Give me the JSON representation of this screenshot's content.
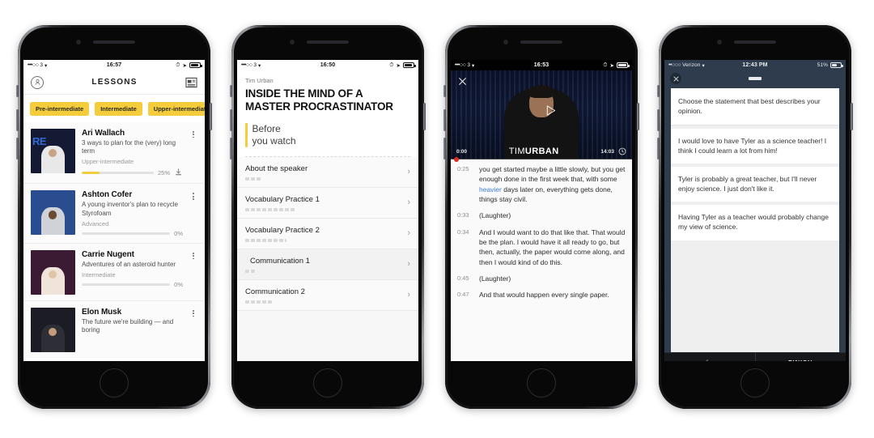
{
  "phones": {
    "p1": {
      "status": {
        "carrier": "3",
        "signal": "•••○○",
        "time": "16:57",
        "battery_pct": 80
      },
      "header": {
        "title": "LESSONS",
        "avatar_icon": "avatar-icon",
        "news_icon": "news-icon"
      },
      "chips": [
        {
          "label": "Pre-intermediate"
        },
        {
          "label": "Intermediate"
        },
        {
          "label": "Upper-intermediate"
        }
      ],
      "lessons": [
        {
          "name": "Ari Wallach",
          "desc": "3 ways to plan for the (very) long term",
          "level": "Upper-intermediate",
          "progress": 25,
          "progress_label": "25%",
          "has_download": true,
          "thumb_text": "RE"
        },
        {
          "name": "Ashton Cofer",
          "desc": "A young inventor's plan to recycle Styrofoam",
          "level": "Advanced",
          "progress": 0,
          "progress_label": "0%",
          "has_download": false,
          "thumb_text": ""
        },
        {
          "name": "Carrie Nugent",
          "desc": "Adventures of an asteroid hunter",
          "level": "Intermediate",
          "progress": 0,
          "progress_label": "0%",
          "has_download": false,
          "thumb_text": ""
        },
        {
          "name": "Elon Musk",
          "desc": "The future we're building — and boring",
          "level": "",
          "progress": 0,
          "progress_label": "",
          "has_download": false,
          "thumb_text": ""
        }
      ]
    },
    "p2": {
      "status": {
        "carrier": "3",
        "signal": "•••○○",
        "time": "16:50",
        "battery_pct": 78
      },
      "speaker": "Tim Urban",
      "title": "INSIDE THE MIND OF A MASTER PROCRASTINATOR",
      "section_line1": "Before",
      "section_line2": "you watch",
      "rows": [
        {
          "title": "About the speaker"
        },
        {
          "title": "Vocabulary Practice 1"
        },
        {
          "title": "Vocabulary Practice 2"
        },
        {
          "title": "Communication 1"
        },
        {
          "title": "Communication 2"
        }
      ]
    },
    "p3": {
      "status": {
        "carrier": "3",
        "signal": "•••○○",
        "time": "16:53",
        "battery_pct": 82
      },
      "video": {
        "close_icon": "close-icon",
        "play_icon": "play-icon",
        "clock_icon": "clock-icon",
        "current_time": "0:00",
        "duration": "14:03",
        "brand_light": "TIM",
        "brand_bold": "URBAN"
      },
      "transcript": [
        {
          "time": "0:25",
          "before": "you get started maybe a little slowly, but you get enough done in the first week that, with some ",
          "highlight": "heavier",
          "after": " days later on, everything gets done, things stay civil."
        },
        {
          "time": "0:33",
          "before": "(Laughter)",
          "highlight": "",
          "after": ""
        },
        {
          "time": "0:34",
          "before": "And I would want to do that like that. That would be the plan. I would have it all ready to go, but then, actually, the paper would come along, and then I would kind of do this.",
          "highlight": "",
          "after": ""
        },
        {
          "time": "0:45",
          "before": "(Laughter)",
          "highlight": "",
          "after": ""
        },
        {
          "time": "0:47",
          "before": "And that would happen every single paper.",
          "highlight": "",
          "after": ""
        }
      ]
    },
    "p4": {
      "status": {
        "carrier": "Verizon",
        "signal": "••○○○",
        "time": "12:43 PM",
        "battery_label": "51%",
        "battery_pct": 51
      },
      "close_icon": "close-icon",
      "prompt": "Choose the statement that best describes your opinion.",
      "options": [
        "I would love to have Tyler as a science teacher! I think I could learn a lot from him!",
        "Tyler is probably a great teacher, but I'll never enjoy science. I just don't like it.",
        "Having Tyler as a teacher would probably change my view of science."
      ],
      "footer": {
        "back_icon": "arrow-left-icon",
        "finish_label": "FINISH"
      }
    }
  },
  "colors": {
    "accent_yellow": "#f4cc3c",
    "navy": "#2e3c4d",
    "link_blue": "#3e7fe0",
    "record_red": "#e02b20"
  }
}
